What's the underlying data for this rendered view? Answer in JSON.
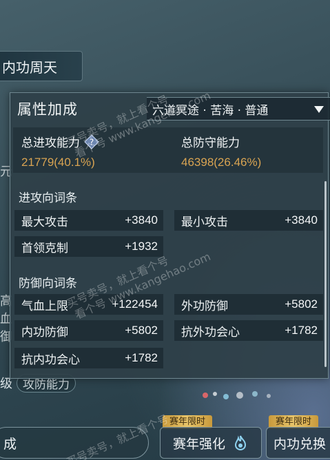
{
  "background": {
    "left_tab": "内功周天",
    "left_edge_top": "元",
    "left_edge_mid": "高\n血\n御",
    "level_char": "级",
    "level_pill": "攻防能力",
    "bottom_left": "成",
    "event_tag_1": "赛年限时",
    "event_btn_1": "赛年强化",
    "event_tag_2": "赛年限时",
    "event_btn_2": "内功兑换"
  },
  "panel": {
    "title": "属性加成",
    "realm_select": "六道冥途 · 苦海 · 普通",
    "total_attack_label": "总进攻能力",
    "total_attack_value": "21779(40.1%)",
    "total_defense_label": "总防守能力",
    "total_defense_value": "46398(26.46%)",
    "attack_section": "进攻向词条",
    "defense_section": "防御向词条",
    "attack_attrs": [
      {
        "name": "最大攻击",
        "value": "+3840"
      },
      {
        "name": "最小攻击",
        "value": "+3840"
      },
      {
        "name": "首领克制",
        "value": "+1932"
      }
    ],
    "defense_attrs": [
      {
        "name": "气血上限",
        "value": "+122454"
      },
      {
        "name": "外功防御",
        "value": "+5802"
      },
      {
        "name": "内功防御",
        "value": "+5802"
      },
      {
        "name": "抗外功会心",
        "value": "+1782"
      },
      {
        "name": "抗内功会心",
        "value": "+1782"
      }
    ]
  },
  "watermark": {
    "line1": "买号卖号，就上看个号",
    "line2": "看个号 www.kangehao.com"
  },
  "colors": {
    "accent_value": "#d9a452",
    "panel_bg": "#2e3f48",
    "event_tag": "#e8c56a"
  },
  "icons": {
    "help": "question-diamond-icon",
    "select": "chevron-down-icon",
    "event": "flame-icon"
  }
}
